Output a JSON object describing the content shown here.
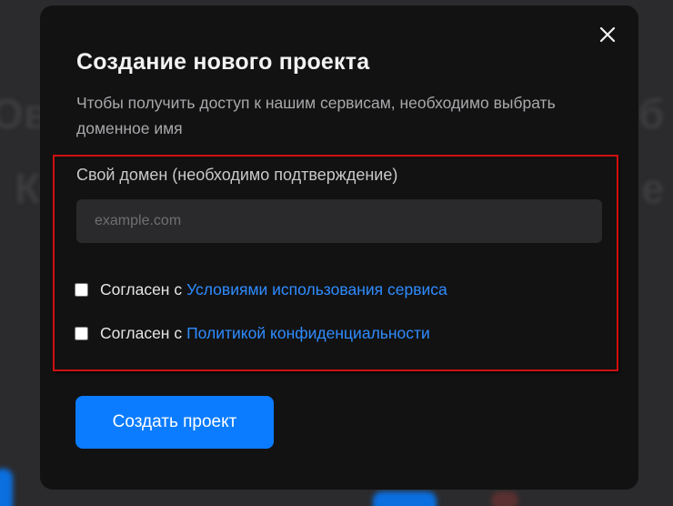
{
  "modal": {
    "title": "Создание нового проекта",
    "subtitle": "Чтобы получить доступ к нашим сервисам, необходимо выбрать доменное имя",
    "close_icon": "close-icon"
  },
  "domain_field": {
    "label": "Свой домен (необходимо подтверждение)",
    "placeholder": "example.com",
    "value": ""
  },
  "agreements": [
    {
      "prefix": "Согласен с",
      "link": "Условиями использования сервиса",
      "checked": false
    },
    {
      "prefix": "Согласен с",
      "link": "Политикой конфиденциальности",
      "checked": false
    }
  ],
  "actions": {
    "create_label": "Создать проект"
  },
  "colors": {
    "modal_bg": "#121212",
    "accent": "#0b7cff",
    "link": "#2f8cff",
    "highlight_border": "#d01010"
  }
}
